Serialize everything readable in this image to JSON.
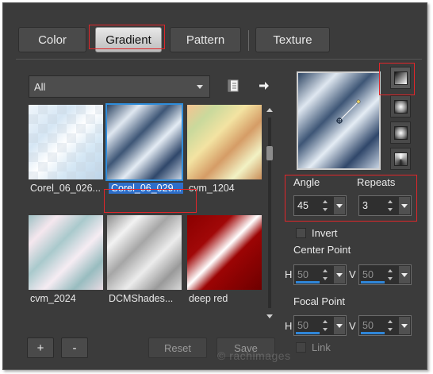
{
  "tabs": [
    {
      "label": "Color"
    },
    {
      "label": "Gradient"
    },
    {
      "label": "Pattern"
    },
    {
      "label": "Texture"
    }
  ],
  "category": {
    "selected": "All"
  },
  "gradients": [
    {
      "name": "Corel_06_026...",
      "style": "linear-gradient(135deg, #f0f6fb 0%, #d5e6f4 30%, #ffffff 50%, #d6e8f5 70%, #bcd3e8 100%)"
    },
    {
      "name": "Corel_06_029...",
      "style": "linear-gradient(135deg, #2e4563 0%, #dfe7f0 22%, #3e5676 42%, #e4ecf4 60%, #30476a 80%, #c7d3e2 100%)"
    },
    {
      "name": "cvm_1204",
      "style": "linear-gradient(135deg, #f5c391 0%, #c9d99c 20%, #f3e3a2 40%, #d59c66 60%, #f2f2c4 80%, #c98d58 100%)"
    },
    {
      "name": "cvm_2024",
      "style": "linear-gradient(135deg, #9fc1c4 0%, #f5e7ee 20%, #a9c9cc 40%, #f6ecf3 60%, #98bcbf 80%, #e8dbe4 100%)"
    },
    {
      "name": "DCMShades...",
      "style": "linear-gradient(135deg, #8d8d8d 0%, #f2f2f2 22%, #a6a6a6 42%, #ececec 62%, #9a9a9a 82%, #d8d8d8 100%)"
    },
    {
      "name": "deep red",
      "style": "linear-gradient(135deg, #8a0000 0%, #a10808 30%, #ffffff 48%, #9c0404 60%, #6e0000 100%)"
    }
  ],
  "buttons": {
    "add": "+",
    "remove": "-",
    "reset": "Reset",
    "save": "Save"
  },
  "angle": {
    "label": "Angle",
    "value": "45"
  },
  "repeats": {
    "label": "Repeats",
    "value": "3"
  },
  "invert": {
    "label": "Invert",
    "checked": false
  },
  "center_point": {
    "label": "Center Point",
    "h_letter": "H",
    "h": "50",
    "v_letter": "V",
    "v": "50"
  },
  "focal_point": {
    "label": "Focal Point",
    "h_letter": "H",
    "h": "50",
    "v_letter": "V",
    "v": "50"
  },
  "link": {
    "label": "Link",
    "checked": false
  },
  "watermark": "© rachimages",
  "colors": {
    "accent": "#2f86d8",
    "annotation": "#e0262a",
    "selection": "#2e6ec9"
  }
}
